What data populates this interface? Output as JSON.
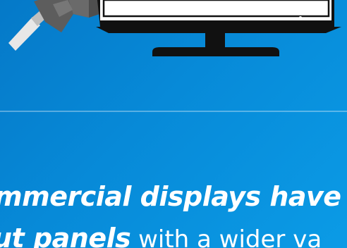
{
  "background": {
    "gradient_start": "#0579c8",
    "gradient_end": "#0b9be6",
    "divider_color": "#5ab7ef"
  },
  "illustration": {
    "icons": {
      "hand": "hand-icon",
      "pen": "pen-icon",
      "display": "display-icon"
    }
  },
  "copy": {
    "headline": "mmercial displays have",
    "subline": {
      "strong": "ut panels",
      "regular": " with a wider va"
    }
  },
  "colors": {
    "text": "#ffffff",
    "display_frame": "#111111",
    "display_screen": "#ffffff",
    "hand": "#5d5d5d",
    "pen": "#e7e7e7"
  }
}
